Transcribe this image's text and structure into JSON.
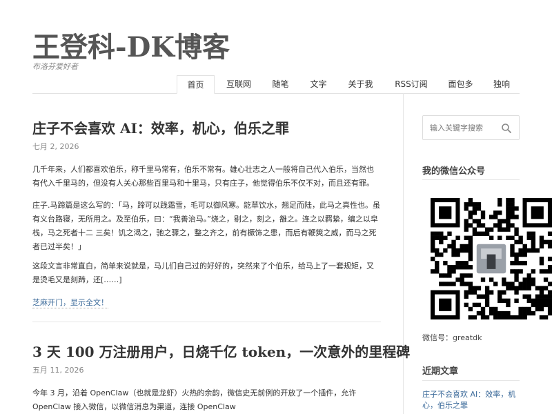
{
  "site": {
    "title": "王登科-DK博客",
    "description": "布洛芬爱好者"
  },
  "nav": {
    "items": [
      "首页",
      "互联网",
      "随笔",
      "文字",
      "关于我",
      "RSS订阅",
      "面包多",
      "独响"
    ],
    "active": "首页"
  },
  "posts": [
    {
      "title": "庄子不会喜欢 AI：效率，机心，伯乐之罪",
      "date": "七月 2, 2026",
      "paragraphs": [
        "几千年来，人们都喜欢伯乐，称千里马常有，伯乐不常有。雄心壮志之人一般将自己代入伯乐，当然也有代入千里马的，但没有人关心那些百里马和十里马，只有庄子，他觉得伯乐不仅不对，而且还有罪。",
        "庄子.马蹄篇是这么写的：「马，蹄可以践霜雪，毛可以御风寒。龁草饮水，翘足而陆，此马之真性也。虽有义台路寝，无所用之。及至伯乐，曰：“我善治马。”烧之，剔之，刻之，雒之。连之以羁絷，编之以皁栈，马之死者十二 三矣！饥之渴之，驰之骤之，整之齐之，前有橛饰之患，而后有鞭筴之威，而马之死者已过半矣！」",
        "这段文言非常直白，简单来说就是，马儿们自己过的好好的，突然来了个伯乐，给马上了一套规矩，又是烫毛又是刻蹄，还[……]"
      ],
      "read_more": "芝麻开门，显示全文！"
    },
    {
      "title": "3 天 100 万注册用户，日烧千亿 token，一次意外的里程碑",
      "date": "五月 11, 2026",
      "paragraphs": [
        "今年 3 月，沿着 OpenClaw（也就是龙虾）火热的余韵，微信史无前例的开放了一个插件，允许 OpenClaw 接入微信，以微信消息为渠道，连接 OpenClaw"
      ]
    }
  ],
  "sidebar": {
    "search_placeholder": "输入关键字搜索",
    "wechat_title": "我的微信公众号",
    "wechat_id": "微信号：greatdk",
    "recent_title": "近期文章",
    "recent_posts": [
      "庄子不会喜欢 AI：效率，机心，伯乐之罪"
    ]
  },
  "icons": {
    "search": "search-icon",
    "qr": "qr-code-icon"
  },
  "colors": {
    "link": "#3b6a9a",
    "title": "#555555",
    "muted": "#888888"
  }
}
